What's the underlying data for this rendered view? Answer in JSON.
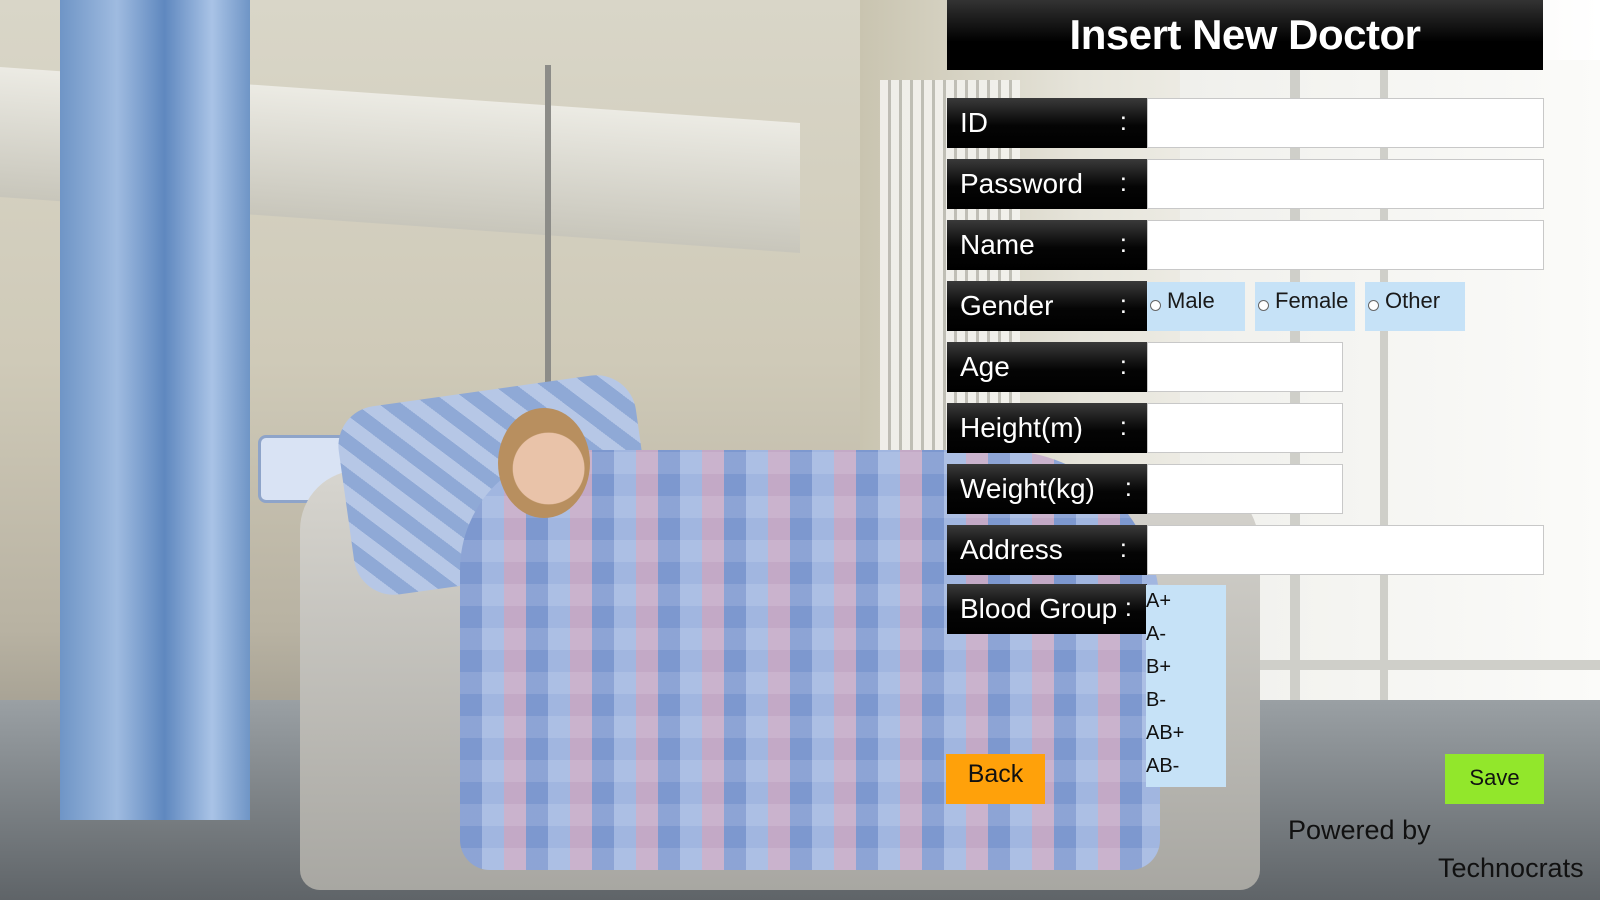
{
  "form": {
    "title": "Insert New Doctor",
    "separator": ":",
    "fields": {
      "id": {
        "label": "ID",
        "value": ""
      },
      "password": {
        "label": "Password",
        "value": ""
      },
      "name": {
        "label": "Name",
        "value": ""
      },
      "gender": {
        "label": "Gender"
      },
      "age": {
        "label": "Age",
        "value": ""
      },
      "height": {
        "label": "Height(m)",
        "value": ""
      },
      "weight": {
        "label": "Weight(kg)",
        "value": ""
      },
      "address": {
        "label": "Address",
        "value": ""
      },
      "blood_group": {
        "label": "Blood Group"
      }
    },
    "gender_options": [
      "Male",
      "Female",
      "Other"
    ],
    "blood_group_options": [
      "A+",
      "A-",
      "B+",
      "B-",
      "AB+",
      "AB-"
    ]
  },
  "buttons": {
    "back_label": "Back",
    "save_label": "Save",
    "back_color": "#ffa10a",
    "save_color": "#92e72b"
  },
  "footer": {
    "powered_by": "Powered by",
    "brand": "Technocrats"
  },
  "colors": {
    "label_bg": "#000000",
    "option_bg": "#c6e2f7"
  }
}
